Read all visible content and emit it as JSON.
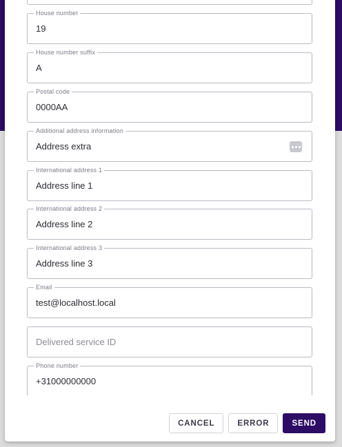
{
  "colors": {
    "backdrop": "#2d0c66",
    "primary": "#2d0c66"
  },
  "form": {
    "house_number": {
      "label": "House number",
      "value": "19"
    },
    "house_number_suffix": {
      "label": "House number suffix",
      "value": "A"
    },
    "postal_code": {
      "label": "Postal code",
      "value": "0000AA"
    },
    "additional_address": {
      "label": "Additional address information",
      "value": "Address extra",
      "icon": "more-dots-icon"
    },
    "intl_address_1": {
      "label": "International address 1",
      "value": "Address line 1"
    },
    "intl_address_2": {
      "label": "International address 2",
      "value": "Address line 2"
    },
    "intl_address_3": {
      "label": "International address 3",
      "value": "Address line 3"
    },
    "email": {
      "label": "Email",
      "value": "test@localhost.local"
    },
    "delivered_service_id": {
      "placeholder": "Delivered service ID"
    },
    "phone_number": {
      "label": "Phone number",
      "value": "+31000000000"
    }
  },
  "actions": {
    "cancel_label": "CANCEL",
    "error_label": "ERROR",
    "send_label": "SEND"
  }
}
